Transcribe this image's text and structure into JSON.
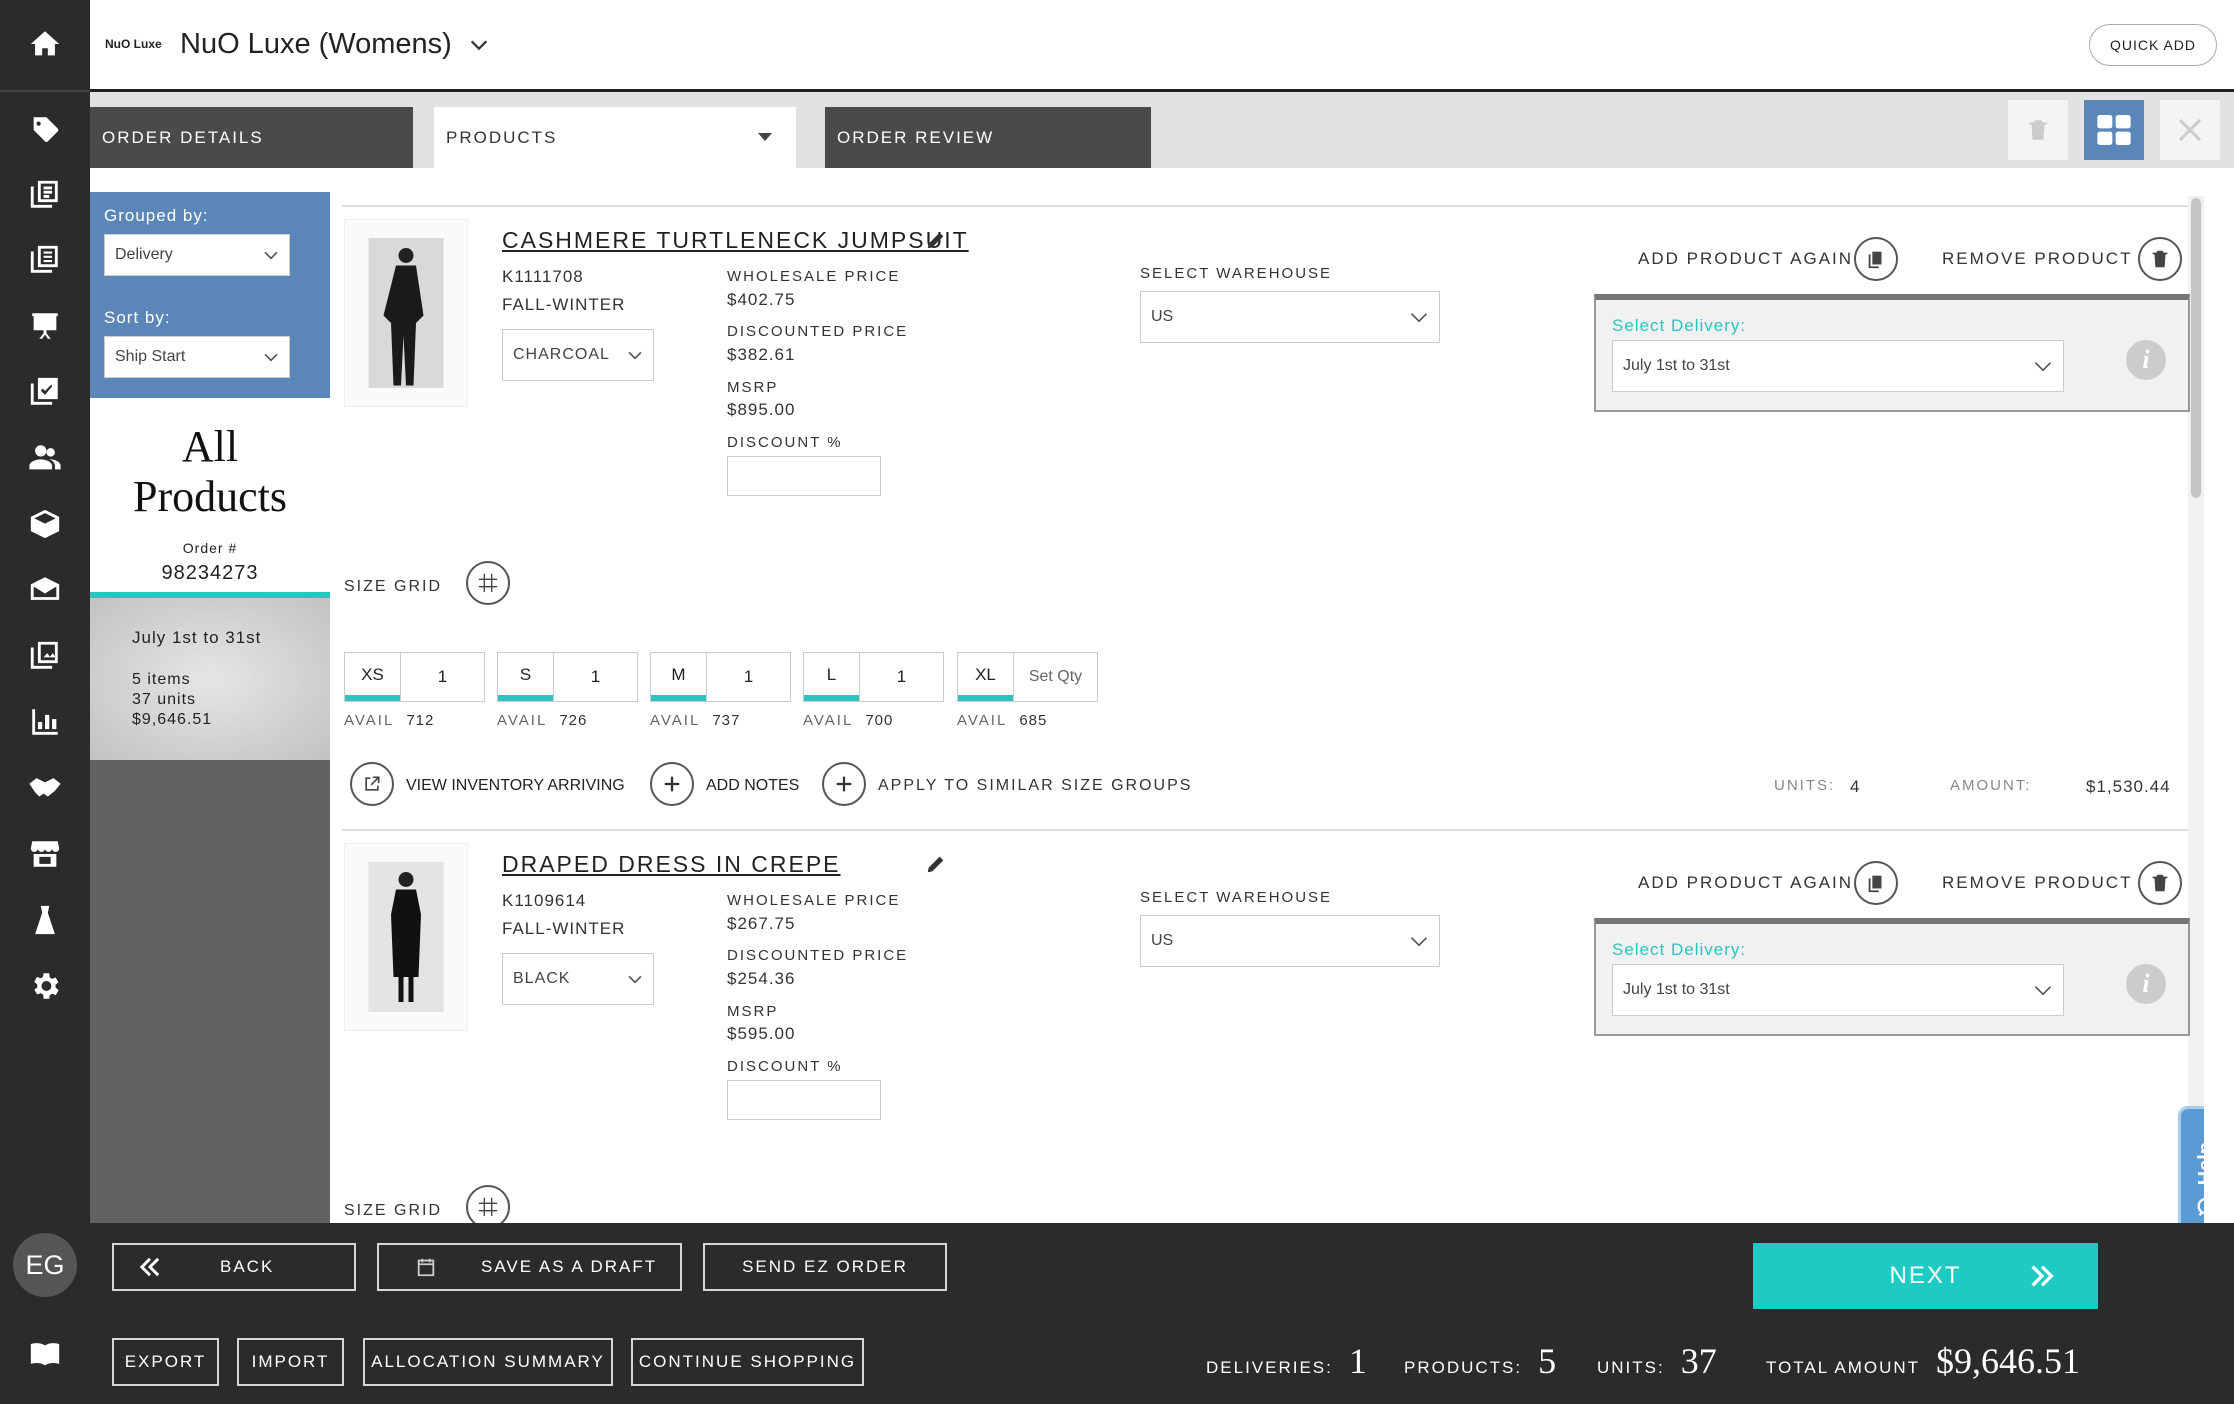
{
  "header": {
    "brand_logo": "NuO Luxe",
    "title": "NuO Luxe (Womens)",
    "quick_add": "QUICK ADD"
  },
  "tabs": [
    {
      "label": "ORDER DETAILS"
    },
    {
      "label": "PRODUCTS"
    },
    {
      "label": "ORDER REVIEW"
    }
  ],
  "sidebar": {
    "grouped_by_label": "Grouped by:",
    "grouped_by_value": "Delivery",
    "sort_by_label": "Sort by:",
    "sort_by_value": "Ship Start",
    "heading_line1": "All",
    "heading_line2": "Products",
    "order_label": "Order #",
    "order_number": "98234273",
    "delivery": {
      "name": "July 1st to 31st",
      "items": "5 items",
      "units": "37 units",
      "amount": "$9,646.51"
    },
    "user_initials": "EG"
  },
  "labels": {
    "wholesale": "WHOLESALE PRICE",
    "discounted": "DISCOUNTED PRICE",
    "msrp": "MSRP",
    "discount_pct": "DISCOUNT %",
    "select_warehouse": "SELECT WAREHOUSE",
    "add_again": "ADD PRODUCT AGAIN",
    "remove": "REMOVE PRODUCT",
    "select_delivery": "Select Delivery:",
    "size_grid": "SIZE GRID",
    "avail": "AVAIL",
    "view_inventory": "VIEW INVENTORY ARRIVING",
    "add_notes": "ADD NOTES",
    "apply_similar": "APPLY TO SIMILAR SIZE GROUPS",
    "units": "UNITS:",
    "amount": "AMOUNT:"
  },
  "products": [
    {
      "name": "CASHMERE TURTLENECK JUMPSUIT",
      "sku": "K1111708",
      "season": "FALL-WINTER",
      "color": "CHARCOAL",
      "wholesale": "$402.75",
      "discounted": "$382.61",
      "msrp": "$895.00",
      "discount": "",
      "warehouse": "US",
      "delivery": "July 1st to 31st",
      "sizes": [
        {
          "size": "XS",
          "qty": "1",
          "avail": "712"
        },
        {
          "size": "S",
          "qty": "1",
          "avail": "726"
        },
        {
          "size": "M",
          "qty": "1",
          "avail": "737"
        },
        {
          "size": "L",
          "qty": "1",
          "avail": "700"
        },
        {
          "size": "XL",
          "qty": "Set Qty",
          "avail": "685"
        }
      ],
      "units": "4",
      "amount": "$1,530.44"
    },
    {
      "name": "DRAPED DRESS IN CREPE",
      "sku": "K1109614",
      "season": "FALL-WINTER",
      "color": "BLACK",
      "wholesale": "$267.75",
      "discounted": "$254.36",
      "msrp": "$595.00",
      "discount": "",
      "warehouse": "US",
      "delivery": "July 1st to 31st"
    }
  ],
  "help": "Help",
  "footer": {
    "back": "BACK",
    "save_draft": "SAVE AS A DRAFT",
    "send_ez": "SEND EZ ORDER",
    "next": "NEXT",
    "export": "EXPORT",
    "import": "IMPORT",
    "allocation": "ALLOCATION SUMMARY",
    "continue": "CONTINUE SHOPPING",
    "deliveries_label": "DELIVERIES:",
    "deliveries": "1",
    "products_label": "PRODUCTS:",
    "products": "5",
    "units_label": "UNITS:",
    "units": "37",
    "total_label": "TOTAL AMOUNT",
    "total": "$9,646.51"
  },
  "colors": {
    "accent": "#2fc2c0",
    "sidebar_blue": "#5b87b8",
    "grid_btn": "#5b87b8"
  }
}
